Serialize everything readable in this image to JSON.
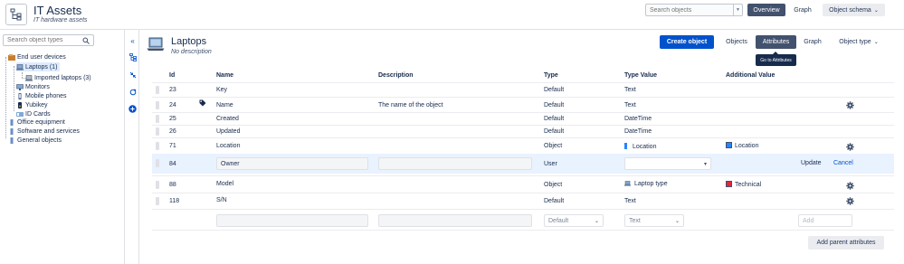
{
  "app": {
    "title": "IT Assets",
    "subtitle": "IT hardware assets"
  },
  "header": {
    "search_placeholder": "Search objects",
    "overview_label": "Overview",
    "graph_label": "Graph",
    "schema_label": "Object schema"
  },
  "sidebar": {
    "search_placeholder": "Search object types",
    "items": [
      {
        "label": "End user devices"
      },
      {
        "label": "Laptops (1)"
      },
      {
        "label": "Imported laptops (3)"
      },
      {
        "label": "Monitors"
      },
      {
        "label": "Mobile phones"
      },
      {
        "label": "Yubikey"
      },
      {
        "label": "ID Cards"
      },
      {
        "label": "Office equipment"
      },
      {
        "label": "Software and services"
      },
      {
        "label": "General objects"
      }
    ]
  },
  "object_type": {
    "title": "Laptops",
    "description": "No description",
    "create_label": "Create object",
    "tabs": [
      "Objects",
      "Attributes",
      "Graph"
    ],
    "object_type_menu": "Object type",
    "tooltip": "Go to Attributes"
  },
  "table": {
    "columns": [
      "Id",
      "Name",
      "Description",
      "Type",
      "Type Value",
      "Additional Value"
    ],
    "rows": [
      {
        "id": "23",
        "name": "Key",
        "description": "",
        "type": "Default",
        "type_value": "Text",
        "additional": ""
      },
      {
        "id": "24",
        "name": "Name",
        "description": "The name of the object",
        "type": "Default",
        "type_value": "Text",
        "additional": ""
      },
      {
        "id": "25",
        "name": "Created",
        "description": "",
        "type": "Default",
        "type_value": "DateTime",
        "additional": ""
      },
      {
        "id": "26",
        "name": "Updated",
        "description": "",
        "type": "Default",
        "type_value": "DateTime",
        "additional": ""
      },
      {
        "id": "71",
        "name": "Location",
        "description": "",
        "type": "Object",
        "type_value": "Location",
        "additional": "Location"
      },
      {
        "id": "84",
        "name": "Owner",
        "description": "",
        "type": "User",
        "type_value": "",
        "additional": ""
      },
      {
        "id": "88",
        "name": "Model",
        "description": "",
        "type": "Object",
        "type_value": "Laptop type",
        "additional": "Technical"
      },
      {
        "id": "118",
        "name": "S/N",
        "description": "",
        "type": "Default",
        "type_value": "Text",
        "additional": ""
      }
    ],
    "edit_update": "Update",
    "edit_cancel": "Cancel",
    "new_row": {
      "type": "Default",
      "type_value": "Text",
      "add_label": "Add"
    },
    "add_parent_label": "Add parent attributes"
  },
  "colors": {
    "location_swatch": "#2684ff",
    "technical_swatch": "#e5243b",
    "primary": "#0052cc"
  }
}
